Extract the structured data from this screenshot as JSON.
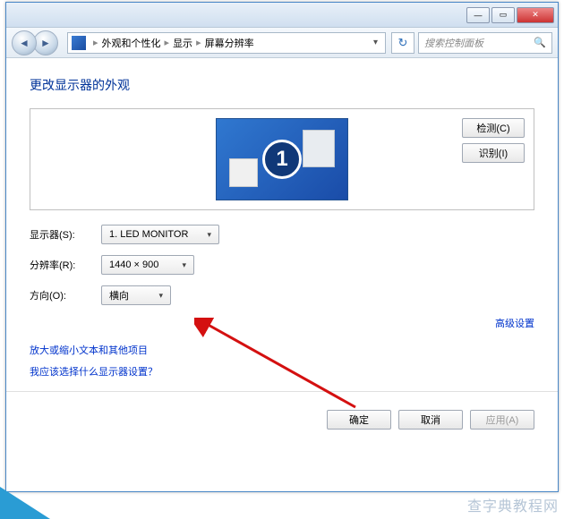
{
  "titlebar": {
    "min": "—",
    "max": "▭",
    "close": "✕"
  },
  "nav": {
    "back": "◄",
    "fwd": "►",
    "bc1": "外观和个性化",
    "bc2": "显示",
    "bc3": "屏幕分辨率",
    "sep": "▸",
    "drop": "▾",
    "refresh": "↻"
  },
  "search": {
    "placeholder": "搜索控制面板",
    "icon": "🔍"
  },
  "page": {
    "title": "更改显示器的外观",
    "monitor_number": "1"
  },
  "buttons": {
    "detect": "检测(C)",
    "identify": "识别(I)"
  },
  "form": {
    "display_label": "显示器(S):",
    "display_value": "1. LED MONITOR",
    "resolution_label": "分辨率(R):",
    "resolution_value": "1440 × 900",
    "orientation_label": "方向(O):",
    "orientation_value": "横向",
    "arrow": "▾"
  },
  "links": {
    "advanced": "高级设置",
    "textsize": "放大或缩小文本和其他项目",
    "which": "我应该选择什么显示器设置？"
  },
  "bottom": {
    "ok": "确定",
    "cancel": "取消",
    "apply": "应用(A)"
  },
  "watermark": "查字典教程网"
}
